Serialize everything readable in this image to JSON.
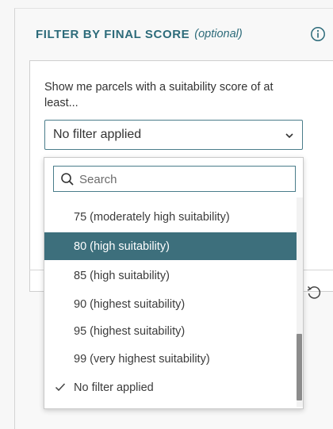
{
  "panel": {
    "title": "FILTER BY FINAL SCORE",
    "optional": "(optional)"
  },
  "filter": {
    "prompt": "Show me parcels with a suitability score of at least...",
    "selected_value": "No filter applied"
  },
  "dropdown": {
    "search_placeholder": "Search",
    "options": [
      {
        "label": "75 (moderately high suitability)",
        "highlighted": false,
        "checked": false
      },
      {
        "label": "80 (high suitability)",
        "highlighted": true,
        "checked": false
      },
      {
        "label": "85 (high suitability)",
        "highlighted": false,
        "checked": false
      },
      {
        "label": "90 (highest suitability)",
        "highlighted": false,
        "checked": false
      },
      {
        "label": "95 (highest suitability)",
        "highlighted": false,
        "checked": false
      },
      {
        "label": "99 (very highest suitability)",
        "highlighted": false,
        "checked": false
      },
      {
        "label": "No filter applied",
        "highlighted": false,
        "checked": true
      }
    ]
  },
  "colors": {
    "accent": "#2d6b7a",
    "highlight": "#3d6f7c",
    "scrollbar": "#8c8c8c"
  },
  "icons": [
    "info-icon",
    "chevron-down-icon",
    "search-icon",
    "check-icon",
    "reset-icon"
  ]
}
